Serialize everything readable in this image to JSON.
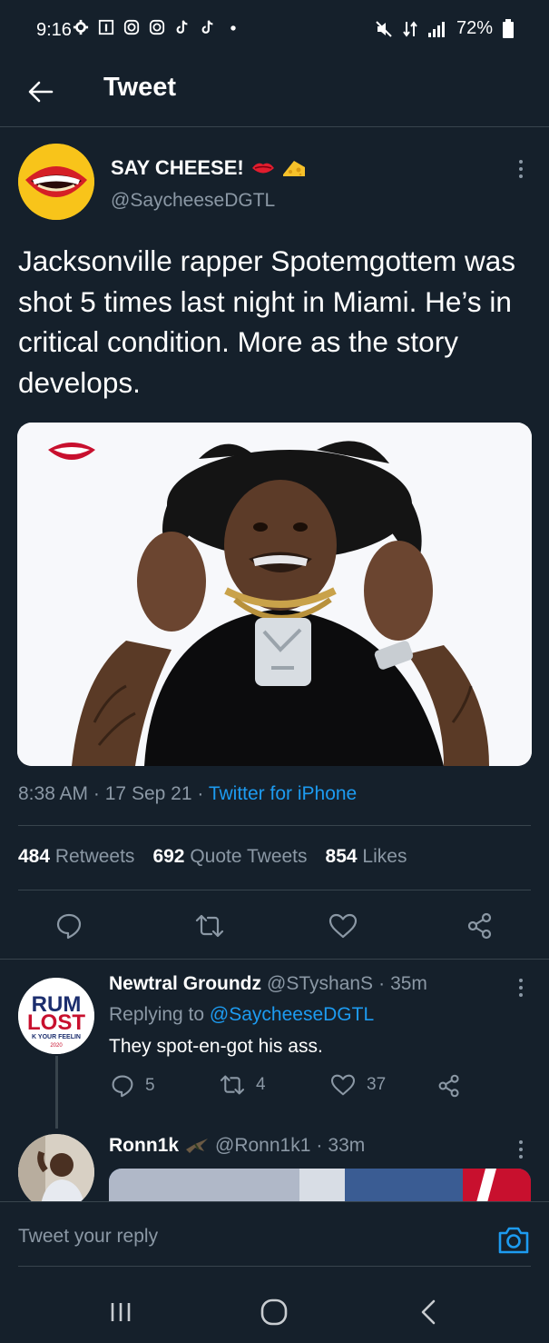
{
  "status_bar": {
    "time": "9:16",
    "battery": "72%",
    "icons": [
      "settings-icon",
      "app-icon",
      "instagram-icon",
      "instagram-icon",
      "tiktok-icon",
      "tiktok-icon",
      "dot-icon"
    ],
    "right_icons": [
      "mute-icon",
      "data-icon",
      "signal-icon",
      "battery-icon"
    ]
  },
  "header": {
    "title": "Tweet",
    "back_icon": "arrow-left-icon"
  },
  "tweet": {
    "author_name": "SAY CHEESE!",
    "author_emoji": "lips-icon cheese-icon",
    "author_handle": "@SaycheeseDGTL",
    "text": "Jacksonville rapper Spotemgottem was shot 5 times last night in Miami. He’s in critical condition. More as the story develops.",
    "time": "8:38 AM",
    "date": "17 Sep 21",
    "source": "Twitter for iPhone",
    "sep": "·",
    "retweets_count": "484",
    "retweets_label": "Retweets",
    "quotes_count": "692",
    "quotes_label": "Quote Tweets",
    "likes_count": "854",
    "likes_label": "Likes"
  },
  "replies": [
    {
      "name": "Newtral Groundz",
      "handle": "@STyshanS",
      "time": "35m",
      "replying_prefix": "Replying to ",
      "replying_to": "@SaycheeseDGTL",
      "text": "They spot-en-got his ass.",
      "reply_count": "5",
      "retweet_count": "4",
      "like_count": "37",
      "avatar_text_top": "RUM",
      "avatar_text_mid": "LOST",
      "avatar_text_bottom": "K YOUR FEELIN",
      "avatar_text_year": "2020"
    },
    {
      "name": "Ronn1k",
      "handle": "@Ronn1k1",
      "time": "33m"
    }
  ],
  "compose": {
    "placeholder": "Tweet your reply"
  },
  "colors": {
    "background": "#15202b",
    "accent": "#1d9bf0",
    "secondary_text": "#8b98a5",
    "divider": "#38444d"
  }
}
